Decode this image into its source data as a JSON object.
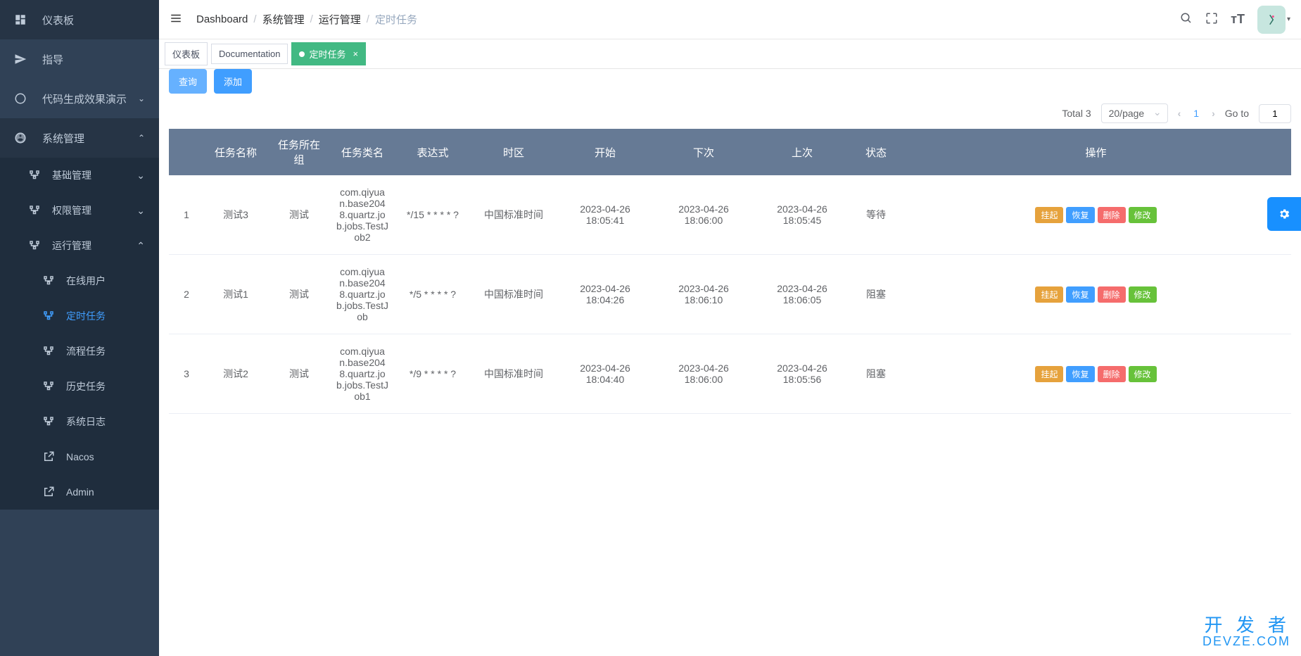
{
  "sidebar": {
    "items": [
      {
        "label": "仪表板",
        "icon": "dashboard"
      },
      {
        "label": "指导",
        "icon": "guide"
      },
      {
        "label": "代码生成效果演示",
        "icon": "code",
        "expandable": true
      },
      {
        "label": "系统管理",
        "icon": "system",
        "expandable": true,
        "open": true
      }
    ],
    "submenu": [
      {
        "label": "基础管理",
        "icon": "tree",
        "expandable": true
      },
      {
        "label": "权限管理",
        "icon": "tree",
        "expandable": true
      },
      {
        "label": "运行管理",
        "icon": "tree",
        "expandable": true,
        "open": true
      }
    ],
    "subsubmenu": [
      {
        "label": "在线用户",
        "icon": "tree"
      },
      {
        "label": "定时任务",
        "icon": "tree",
        "active": true
      },
      {
        "label": "流程任务",
        "icon": "tree"
      },
      {
        "label": "历史任务",
        "icon": "tree"
      },
      {
        "label": "系统日志",
        "icon": "tree"
      },
      {
        "label": "Nacos",
        "icon": "link"
      },
      {
        "label": "Admin",
        "icon": "link"
      }
    ]
  },
  "breadcrumb": [
    "Dashboard",
    "系统管理",
    "运行管理",
    "定时任务"
  ],
  "tabs": [
    {
      "label": "仪表板",
      "active": false
    },
    {
      "label": "Documentation",
      "active": false
    },
    {
      "label": "定时任务",
      "active": true,
      "closable": true
    }
  ],
  "toolbar": {
    "query": "查询",
    "add": "添加"
  },
  "pagination": {
    "total_label": "Total 3",
    "page_size": "20/page",
    "current": "1",
    "goto_label": "Go to",
    "goto_value": "1"
  },
  "table": {
    "headers": [
      "",
      "任务名称",
      "任务所在组",
      "任务类名",
      "表达式",
      "时区",
      "开始",
      "下次",
      "上次",
      "状态",
      "操作"
    ],
    "rows": [
      {
        "idx": "1",
        "name": "测试3",
        "group": "测试",
        "class": "com.qiyuan.base2048.quartz.job.jobs.TestJob2",
        "expr": "*/15 * * * * ?",
        "tz": "中国标准时间",
        "start": "2023-04-26 18:05:41",
        "next": "2023-04-26 18:06:00",
        "last": "2023-04-26 18:05:45",
        "status": "等待"
      },
      {
        "idx": "2",
        "name": "测试1",
        "group": "测试",
        "class": "com.qiyuan.base2048.quartz.job.jobs.TestJob",
        "expr": "*/5 * * * * ?",
        "tz": "中国标准时间",
        "start": "2023-04-26 18:04:26",
        "next": "2023-04-26 18:06:10",
        "last": "2023-04-26 18:06:05",
        "status": "阻塞"
      },
      {
        "idx": "3",
        "name": "测试2",
        "group": "测试",
        "class": "com.qiyuan.base2048.quartz.job.jobs.TestJob1",
        "expr": "*/9 * * * * ?",
        "tz": "中国标准时间",
        "start": "2023-04-26 18:04:40",
        "next": "2023-04-26 18:06:00",
        "last": "2023-04-26 18:05:56",
        "status": "阻塞"
      }
    ],
    "actions": {
      "suspend": "挂起",
      "resume": "恢复",
      "delete": "删除",
      "edit": "修改"
    }
  },
  "watermark": {
    "line1": "开 发 者",
    "line2": "DEVZE.COM"
  }
}
